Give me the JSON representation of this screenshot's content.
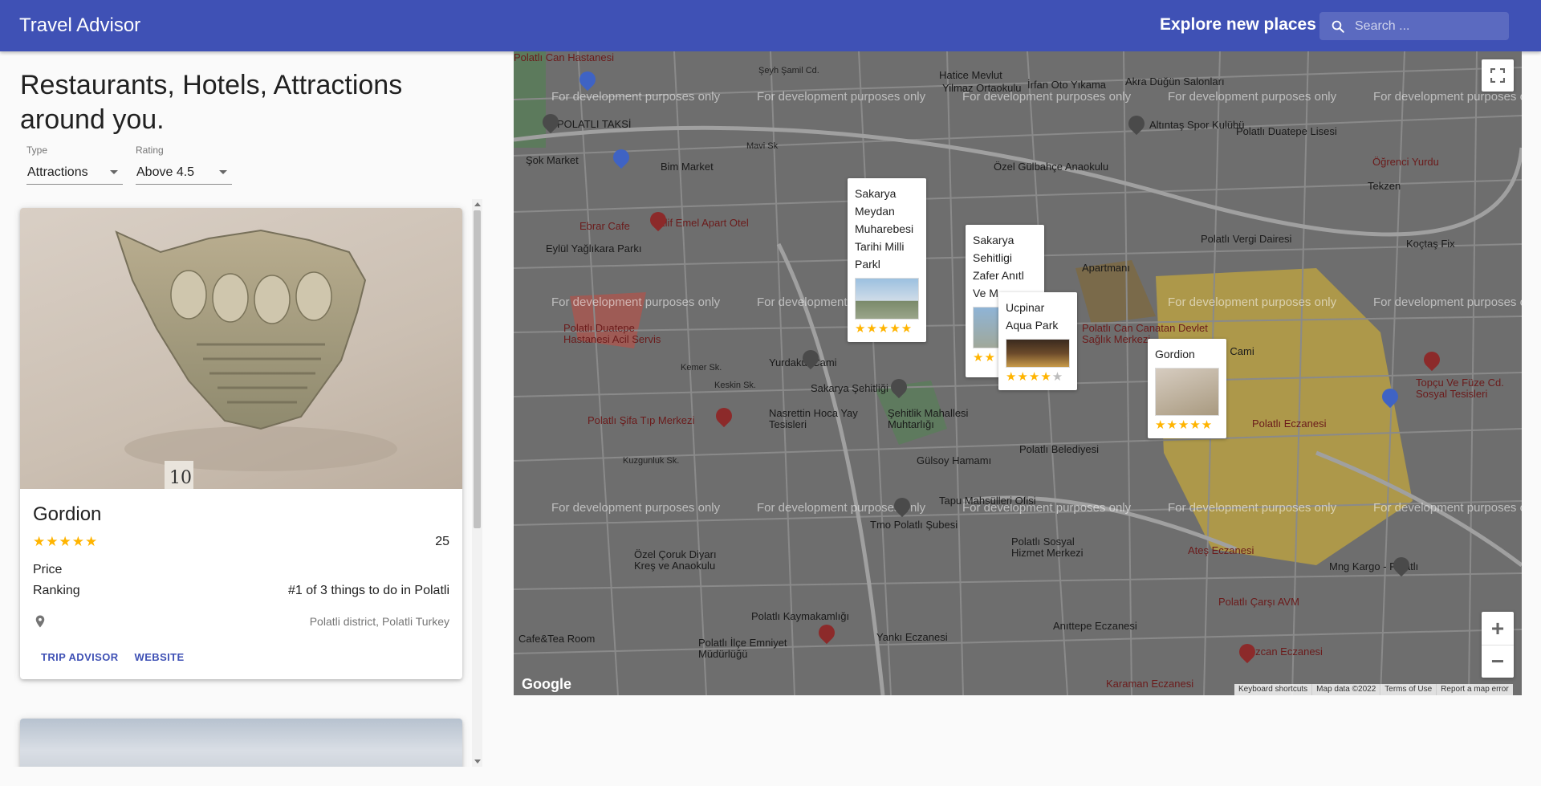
{
  "appbar": {
    "title": "Travel Advisor",
    "explore": "Explore new places",
    "search_placeholder": "Search ..."
  },
  "page": {
    "heading": "Restaurants, Hotels, Attractions around you."
  },
  "filters": {
    "type_label": "Type",
    "type_value": "Attractions",
    "rating_label": "Rating",
    "rating_value": "Above 4.5"
  },
  "places": [
    {
      "name": "Gordion",
      "rating": 5,
      "stars": "★★★★★",
      "reviews": "25",
      "price_label": "Price",
      "ranking_label": "Ranking",
      "ranking": "#1 of 3 things to do in Polatli",
      "address": "Polatli district, Polatli Turkey",
      "trip_advisor": "Trip Advisor",
      "website": "Website"
    }
  ],
  "map": {
    "watermark": "For development purposes only",
    "google": "Google",
    "attribution": [
      "Keyboard shortcuts",
      "Map data ©2022",
      "Terms of Use",
      "Report a map error"
    ],
    "zoom_in": "+",
    "zoom_out": "−",
    "labels": [
      "Şeyh Şamil Cd.",
      "Hatice Mevlut",
      "Yilmaz Ortaokulu",
      "İrfan Oto Yıkama",
      "Akra Düğün Salonları",
      "POLATLI TAKSİ",
      "Altıntaş Spor Kulübü",
      "Polatlı Duatepe Lisesi",
      "Öğrenci Yurdu",
      "Şok Market",
      "Bim Market",
      "Özel Gülbahçe Anaokulu",
      "Tekzen",
      "Ebrar Cafe",
      "Elif Emel Apart Otel",
      "Eylül Yağlıkara Parkı",
      "Polatlı Vergi Dairesi",
      "Koçtaş Fix",
      "Apartmanı",
      "Polatlı Duatepe Hastanesi Acil Servis",
      "Polatlı Can Canatan Devlet Sağlık Merkezi",
      "Polatlı Çarşı Cami",
      "Yurdakul Cami",
      "Sakarya Şehitliği",
      "Nasrettin Hoca Yay Tesisleri",
      "Şehitlik Mahallesi Muhtarlığı",
      "Polatlı Şifa Tıp Merkezi",
      "Topçu Ve Füze Cd. Sosyal Tesisleri",
      "Polatlı Eczanesi",
      "Gülsoy Hamamı",
      "Polatlı Belediyesi",
      "Polatlı Şubesi",
      "Tmo Polatlı Şubesi",
      "Tapu Mahsülleri Ofisi",
      "Polatlı Sosyal Hizmet Merkezi",
      "Ateş Eczanesi",
      "Mng Kargo - Polatlı",
      "Özel Çoruk Diyarı Kreş ve Anaokulu",
      "Anıttepe Eczanesi",
      "Polatlı Çarşı AVM",
      "Polatlı Kaymakamlığı",
      "Polatlı İlçe Emniyet Müdürlüğü",
      "Yankı Eczanesi",
      "Özcan Eczanesi",
      "Karaman Eczanesi",
      "Polatlı Can Hastanesi",
      "Cafe&Tea Room",
      "Kuzgunluk Sk.",
      "Mavi Sk",
      "Kemer Sk.",
      "Keskin Sk."
    ],
    "markers": [
      {
        "title": "Sakarya Meydan Muharebesi Tarihi Milli Parkl",
        "stars": "★★★★★",
        "empty": ""
      },
      {
        "title": "Sakarya Sehitligi Zafer Anıtl Ve M...",
        "stars": "★★",
        "empty": ""
      },
      {
        "title": "Ucpinar Aqua Park",
        "stars": "★★★★",
        "empty": "★"
      },
      {
        "title": "Gordion",
        "stars": "★★★★★",
        "empty": ""
      }
    ]
  }
}
